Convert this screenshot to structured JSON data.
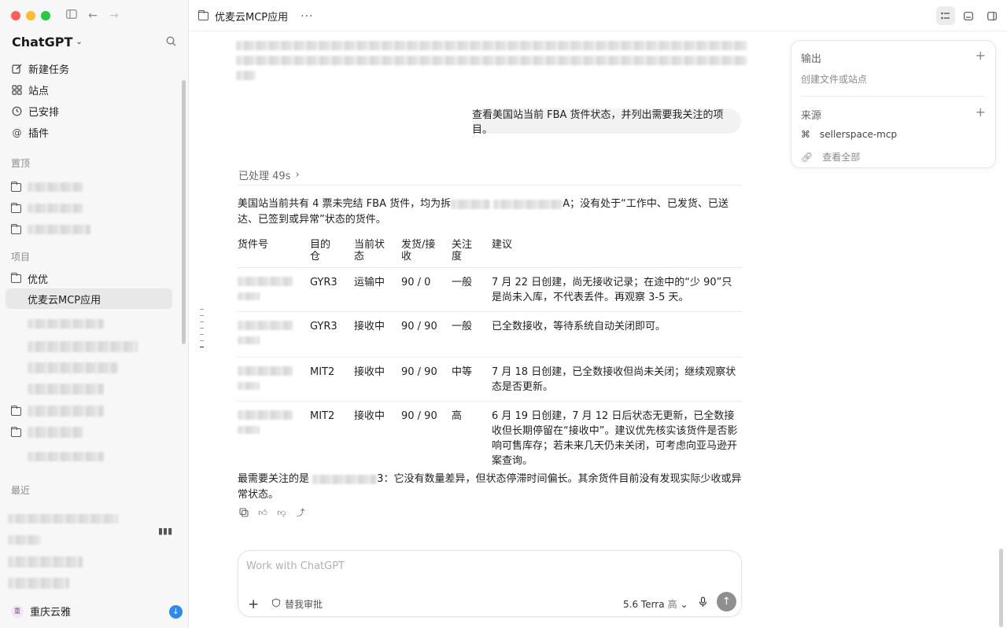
{
  "sidebar": {
    "app_name": "ChatGPT",
    "nav": [
      {
        "label": "新建任务",
        "icon": "edit-icon"
      },
      {
        "label": "站点",
        "icon": "grid-icon"
      },
      {
        "label": "已安排",
        "icon": "clock-icon"
      },
      {
        "label": "插件",
        "icon": "at-icon"
      }
    ],
    "pinned_label": "置顶",
    "projects_label": "项目",
    "project_folder": "优优",
    "active_project": "优麦云MCP应用",
    "recent_label": "最近",
    "user_name": "重庆云雅",
    "user_avatar": "重"
  },
  "header": {
    "title": "优麦云MCP应用",
    "more": "···"
  },
  "conversation": {
    "user_message": "查看美国站当前 FBA 货件状态，并列出需要我关注的项目。",
    "processed": "已处理 49s",
    "summary_prefix": "美国站当前共有 4 票未完结 FBA 货件，均为拆",
    "summary_mid_tail": "A",
    "summary_suffix": "；没有处于“工作中、已发货、已送达、已签到或异常”状态的货件。",
    "table": {
      "headers": [
        "货件号",
        "目的仓",
        "当前状态",
        "发货/接收",
        "关注度",
        "建议"
      ],
      "rows": [
        {
          "warehouse": "GYR3",
          "status": "运输中",
          "qty": "90 / 0",
          "level": "一般",
          "advice": "7 月 22 日创建，尚无接收记录；在途中的“少 90”只是尚未入库，不代表丢件。再观察 3-5 天。"
        },
        {
          "warehouse": "GYR3",
          "status": "接收中",
          "qty": "90 / 90",
          "level": "一般",
          "advice": "已全数接收，等待系统自动关闭即可。"
        },
        {
          "warehouse": "MIT2",
          "status": "接收中",
          "qty": "90 / 90",
          "level": "中等",
          "advice": "7 月 18 日创建，已全数接收但尚未关闭；继续观察状态是否更新。"
        },
        {
          "warehouse": "MIT2",
          "status": "接收中",
          "qty": "90 / 90",
          "level": "高",
          "advice": "6 月 19 日创建，7 月 12 日后状态无更新，已全数接收但长期停留在“接收中”。建议优先核实该货件是否影响可售库存；若未来几天仍未关闭，可考虑向亚马逊开案查询。"
        }
      ]
    },
    "focus_prefix": "最需要关注的是",
    "focus_tail": "3",
    "focus_suffix": "：它没有数量差异，但状态停滞时间偏长。其余货件目前没有发现实际少收或异常状态。"
  },
  "composer": {
    "placeholder": "Work with ChatGPT",
    "approve_label": "替我审批",
    "model": "5.6 Terra",
    "level": "高"
  },
  "right_panel": {
    "output_title": "输出",
    "output_hint": "创建文件或站点",
    "sources_title": "来源",
    "source_item": "sellerspace-mcp",
    "view_all": "查看全部"
  }
}
